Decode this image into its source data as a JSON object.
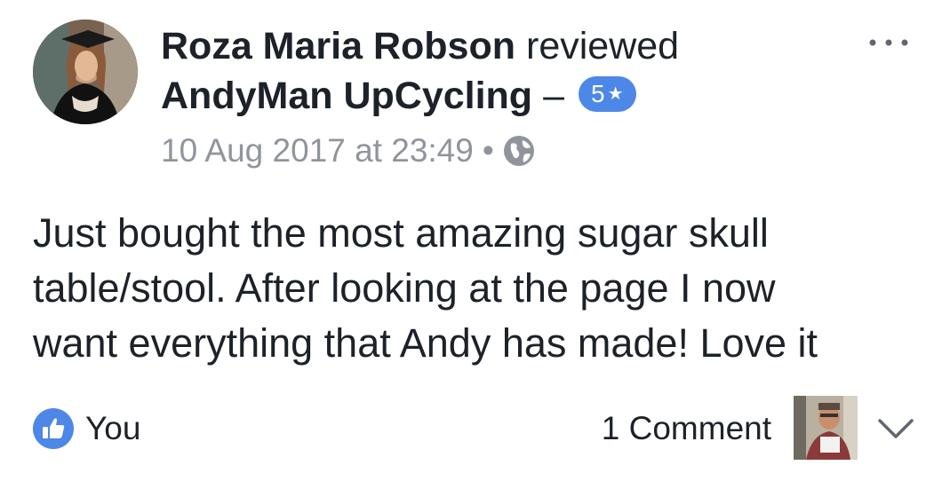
{
  "review": {
    "author": "Roza Maria Robson",
    "action": "reviewed",
    "page_name": "AndyMan UpCycling",
    "separator": "–",
    "rating": "5",
    "rating_star": "★",
    "timestamp": "10 Aug 2017 at 23:49",
    "meta_separator": "•",
    "privacy_icon": "globe-icon",
    "more_icon": "more-dots-icon"
  },
  "body": {
    "lines": [
      "Just bought the most amazing sugar skull",
      "table/stool. After looking at the page I now",
      "want everything that Andy has made! Love it"
    ]
  },
  "footer": {
    "like_icon": "like-thumb-icon",
    "likers": "You",
    "comments_label": "1 Comment",
    "chevron_icon": "chevron-down-icon"
  },
  "colors": {
    "accent": "#4d87e8",
    "text": "#1d2129",
    "secondary": "#90949c"
  }
}
